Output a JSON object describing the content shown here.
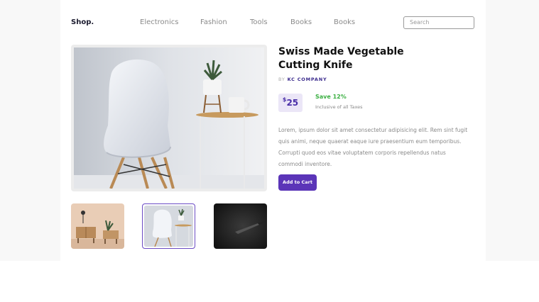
{
  "header": {
    "logo": "Shop.",
    "nav": [
      "Electronics",
      "Fashion",
      "Tools",
      "Books",
      "Books"
    ],
    "search_placeholder": "Search"
  },
  "product": {
    "title": "Swiss Made Vegetable Cutting Knife",
    "brand_prefix": "BY",
    "brand": "KC COMPANY",
    "currency": "$",
    "price": "25",
    "save": "Save 12%",
    "tax_note": "Inclusive of all Taxes",
    "description": "Lorem, ipsum dolor sit amet consectetur adipisicing elit. Rem sint fugit quis animi, neque quaerat eaque iure praesentium eum temporibus. Corrupti quod eos vitae voluptatem corporis repellendus natus commodi inventore.",
    "add_to_cart": "Add to Cart"
  },
  "gallery": {
    "main_image": "chair-with-side-table-photo",
    "thumbnails": [
      "room-with-cabinet-photo",
      "chair-with-side-table-photo",
      "dark-knife-photo"
    ],
    "active_index": 1
  },
  "colors": {
    "accent": "#5b35b8",
    "save_green": "#3cb043",
    "price_bg": "#ebe6f7"
  }
}
